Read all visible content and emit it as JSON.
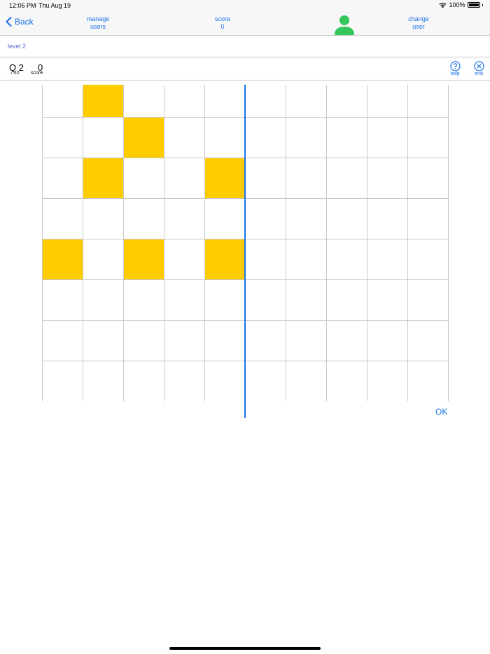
{
  "status": {
    "time": "12:06 PM",
    "date": "Thu Aug 19",
    "battery": "100%"
  },
  "nav": {
    "back_label": "Back",
    "manage_line1": "manage",
    "manage_line2": "users",
    "score_label": "score",
    "score_value": "0",
    "change_line1": "change",
    "change_line2": "user"
  },
  "level": {
    "label": "level 2"
  },
  "info": {
    "question": "Q 2",
    "total": "/ 10",
    "score_value": "0",
    "score_label": "score"
  },
  "tools": {
    "help_label": "help",
    "end_label": "end"
  },
  "grid": {
    "columns": 10,
    "rows": 8,
    "filled": [
      [
        0,
        1
      ],
      [
        1,
        2
      ],
      [
        2,
        1
      ],
      [
        2,
        4
      ],
      [
        4,
        0
      ],
      [
        4,
        2
      ],
      [
        4,
        4
      ]
    ]
  },
  "ok_label": "OK",
  "colors": {
    "accent": "#1a73e8",
    "filled": "#ffcc00",
    "avatar": "#34c759"
  }
}
